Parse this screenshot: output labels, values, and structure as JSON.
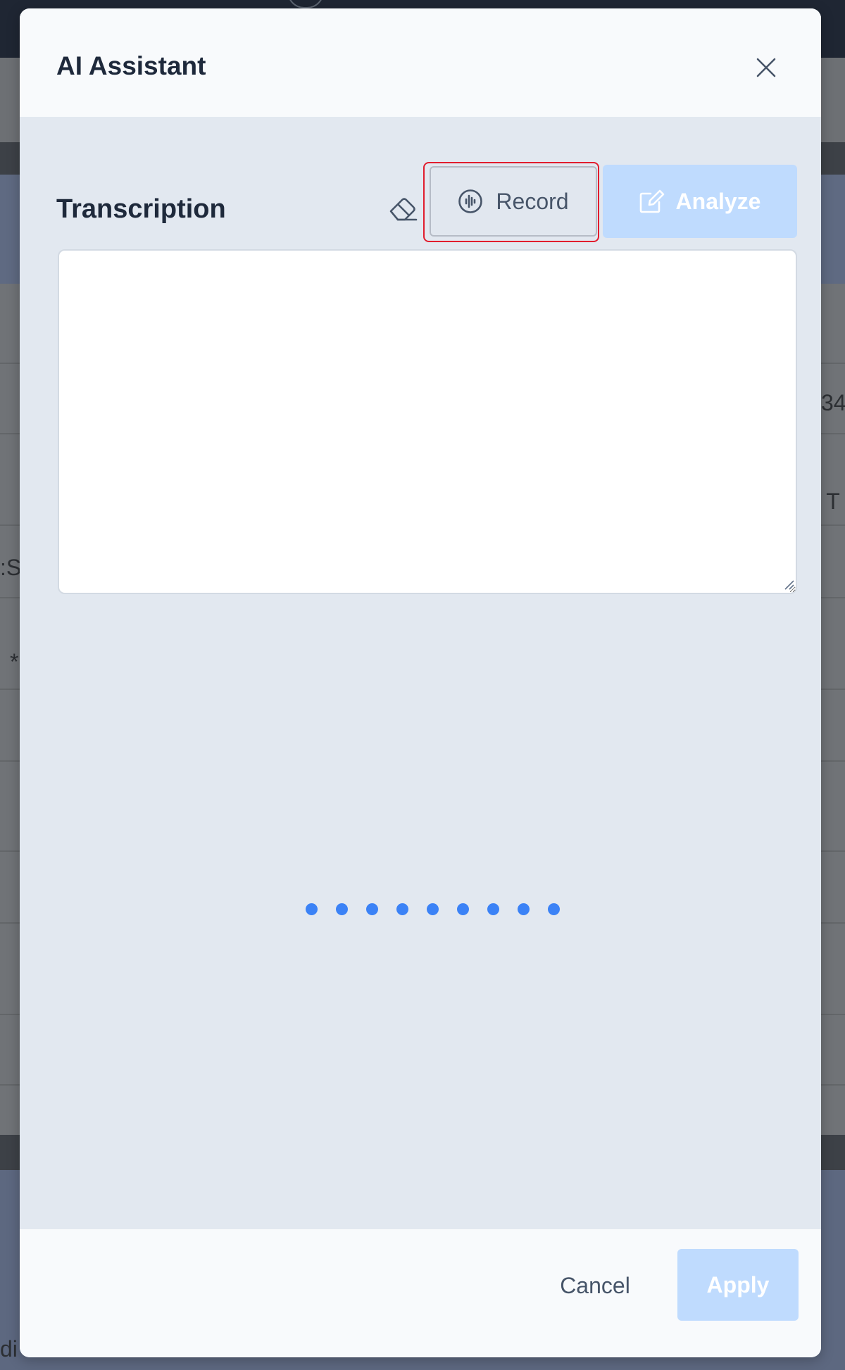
{
  "background": {
    "fragments": [
      "34",
      ": T",
      ":S",
      "*",
      "di"
    ]
  },
  "modal": {
    "title": "AI Assistant",
    "close_icon": "close-icon"
  },
  "transcription": {
    "heading": "Transcription",
    "clear_icon": "eraser-icon",
    "record_label": "Record",
    "record_icon": "audio-wave-icon",
    "analyze_label": "Analyze",
    "analyze_icon": "edit-icon",
    "value": "",
    "placeholder": ""
  },
  "loading": {
    "dot_count": 9,
    "color": "#3b82f6"
  },
  "footer": {
    "cancel_label": "Cancel",
    "apply_label": "Apply"
  },
  "colors": {
    "accent_disabled": "#bfdbfe",
    "highlight": "#e11d2e",
    "modal_body": "#e2e8f0",
    "modal_header": "#f8fafc",
    "title_text": "#1e293b"
  }
}
